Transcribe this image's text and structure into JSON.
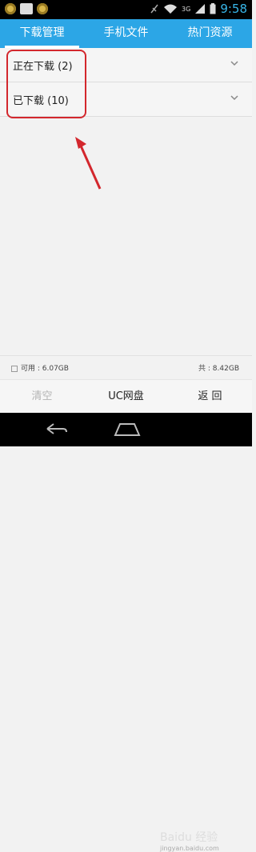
{
  "statusbar": {
    "time": "9:58",
    "network": "3G"
  },
  "tabs": [
    {
      "label": "下载管理"
    },
    {
      "label": "手机文件"
    },
    {
      "label": "热门资源"
    }
  ],
  "downloads": {
    "items": [
      {
        "label": "正在下载 (2)"
      },
      {
        "label": "已下载 (10)"
      }
    ]
  },
  "storage": {
    "free": "可用 : 6.07GB",
    "total": "共 : 8.42GB"
  },
  "actions": {
    "clear": "清空",
    "uc_disk": "UC网盘",
    "back": "返 回"
  },
  "watermark": {
    "brand": "Baidu 经验",
    "url": "jingyan.baidu.com"
  },
  "colors": {
    "accent": "#2ca6e6",
    "highlight": "#d3272d"
  }
}
